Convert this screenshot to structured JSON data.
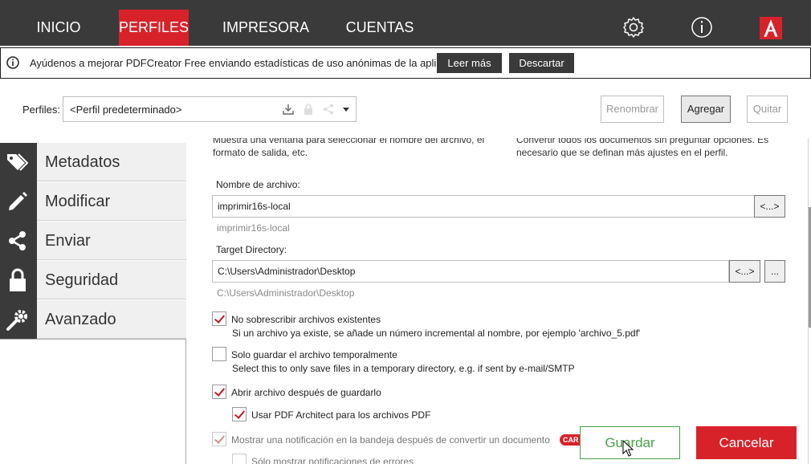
{
  "nav": {
    "tabs": [
      {
        "label": "INICIO"
      },
      {
        "label": "PERFILES"
      },
      {
        "label": "IMPRESORA"
      },
      {
        "label": "CUENTAS"
      }
    ],
    "active_tab": "PERFILES",
    "icons": [
      "gear-icon",
      "info-icon",
      "pdfcreator-logo"
    ],
    "accent_color": "#d8222a"
  },
  "infobar": {
    "icon": "info-icon",
    "message": "Ayúdenos a mejorar PDFCreator Free enviando estadísticas de uso anónimas de la aplicación.",
    "read_more": "Leer más",
    "dismiss": "Descartar"
  },
  "profiles": {
    "label": "Perfiles:",
    "selected": "<Perfil predeterminado>",
    "rename": "Renombrar",
    "add": "Agregar",
    "remove": "Quitar"
  },
  "sidebar": {
    "items": [
      {
        "label": "Metadatos",
        "icon": "tags-icon"
      },
      {
        "label": "Modificar",
        "icon": "pencil-icon"
      },
      {
        "label": "Enviar",
        "icon": "share-icon"
      },
      {
        "label": "Seguridad",
        "icon": "lock-icon"
      },
      {
        "label": "Avanzado",
        "icon": "wrench-gear-icon"
      }
    ]
  },
  "main": {
    "desc_left": "Muestra una ventana para seleccionar el nombre del archivo, el formato de salida, etc.",
    "desc_right": "Convertir todos los documentos sin preguntar opciones. Es necesario que se definan más ajustes en el perfil.",
    "filename_label": "Nombre de archivo:",
    "filename_value": "imprimir16s-local",
    "filename_hint": "imprimir16s-local",
    "token_button": "<...>",
    "target_label": "Target Directory:",
    "target_value": "C:\\Users\\Administrador\\Desktop",
    "target_hint": "C:\\Users\\Administrador\\Desktop",
    "browse_button": "...",
    "options": [
      {
        "label": "No sobrescribir archivos existentes",
        "sub": "Si un archivo ya existe, se añade un número incremental al nombre, por ejemplo 'archivo_5.pdf'",
        "checked": true
      },
      {
        "label": "Solo guardar el archivo temporalmente",
        "sub": "Select this to only save files in a temporary directory, e.g. if sent by e-mail/SMTP",
        "checked": false
      },
      {
        "label": "Abrir archivo después de guardarlo",
        "checked": true
      },
      {
        "label": "Usar PDF Architect para los archivos PDF",
        "checked": true
      },
      {
        "label": "Mostrar una notificación en la bandeja después de convertir un documento",
        "checked": true,
        "disabled": true
      },
      {
        "label": "Sólo mostrar notificaciones de errores",
        "checked": false,
        "disabled": true
      }
    ],
    "badge": "CAR"
  },
  "footer": {
    "save": "Guardar",
    "cancel": "Cancelar"
  }
}
